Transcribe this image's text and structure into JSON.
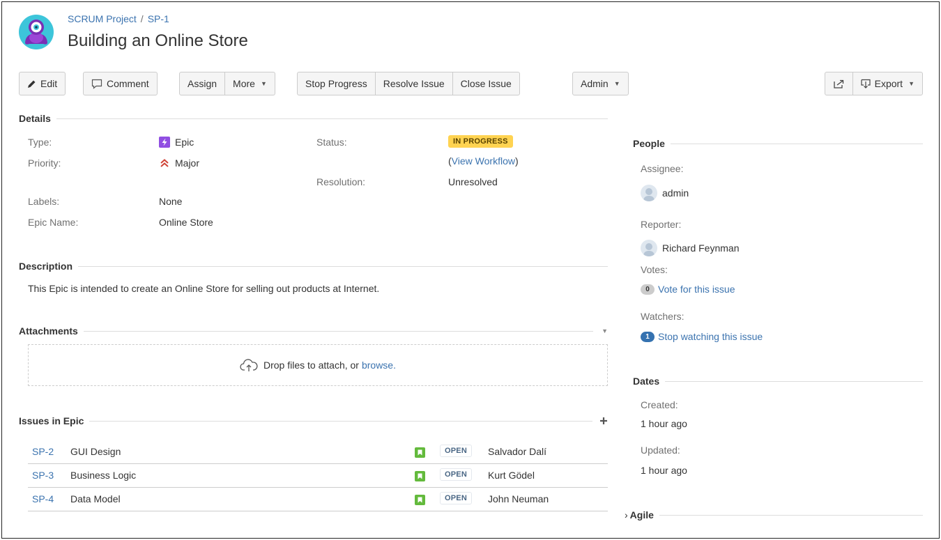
{
  "breadcrumb": {
    "project": "SCRUM Project",
    "separator": "/",
    "issue_key": "SP-1"
  },
  "title": "Building an Online Store",
  "toolbar": {
    "edit": "Edit",
    "comment": "Comment",
    "assign": "Assign",
    "more": "More",
    "stop_progress": "Stop Progress",
    "resolve_issue": "Resolve Issue",
    "close_issue": "Close Issue",
    "admin": "Admin",
    "export": "Export"
  },
  "details": {
    "heading": "Details",
    "type_label": "Type:",
    "type_value": "Epic",
    "priority_label": "Priority:",
    "priority_value": "Major",
    "labels_label": "Labels:",
    "labels_value": "None",
    "epic_name_label": "Epic Name:",
    "epic_name_value": "Online Store",
    "status_label": "Status:",
    "status_value": "IN PROGRESS",
    "view_workflow_open": "(",
    "view_workflow": "View Workflow",
    "view_workflow_close": ")",
    "resolution_label": "Resolution:",
    "resolution_value": "Unresolved"
  },
  "description": {
    "heading": "Description",
    "text": "This Epic is intended to create an Online Store for selling out products at Internet."
  },
  "attachments": {
    "heading": "Attachments",
    "drop_text": "Drop files to attach, or",
    "browse": "browse."
  },
  "issues_in_epic": {
    "heading": "Issues in Epic",
    "rows": [
      {
        "key": "SP-2",
        "summary": "GUI Design",
        "status": "OPEN",
        "assignee": "Salvador Dalí"
      },
      {
        "key": "SP-3",
        "summary": "Business Logic",
        "status": "OPEN",
        "assignee": "Kurt Gödel"
      },
      {
        "key": "SP-4",
        "summary": "Data Model",
        "status": "OPEN",
        "assignee": "John Neuman"
      }
    ]
  },
  "people": {
    "heading": "People",
    "assignee_label": "Assignee:",
    "assignee": "admin",
    "reporter_label": "Reporter:",
    "reporter": "Richard Feynman",
    "votes_label": "Votes:",
    "votes_count": "0",
    "vote_link": "Vote for this issue",
    "watchers_label": "Watchers:",
    "watchers_count": "1",
    "watch_link": "Stop watching this issue"
  },
  "dates": {
    "heading": "Dates",
    "created_label": "Created:",
    "created": "1 hour ago",
    "updated_label": "Updated:",
    "updated": "1 hour ago"
  },
  "agile": {
    "heading": "Agile",
    "toggle": "›"
  },
  "colors": {
    "link": "#3b73af",
    "status_in_progress_bg": "#ffd351",
    "epic_purple": "#904ee2",
    "story_green": "#63ba3c",
    "priority_red": "#d04437",
    "badge_blue": "#3572b0"
  },
  "icons": {
    "project_avatar": "project-avatar",
    "edit": "pencil-icon",
    "comment": "comment-bubble-icon",
    "share": "share-icon",
    "export": "export-icon",
    "upload": "cloud-upload-icon",
    "add": "plus-icon",
    "collapse": "caret-down-icon"
  }
}
